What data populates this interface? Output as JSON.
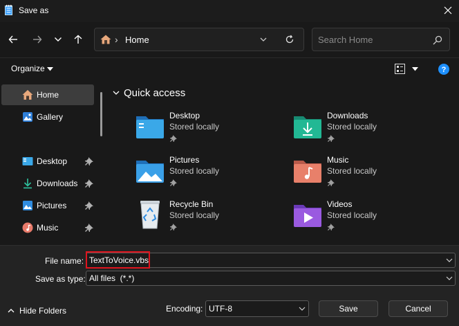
{
  "window": {
    "title": "Save as"
  },
  "address": {
    "location": "Home",
    "separator": "›"
  },
  "search": {
    "placeholder": "Search Home"
  },
  "toolbar": {
    "organize_label": "Organize"
  },
  "sidebar": {
    "items": [
      {
        "label": "Home",
        "icon": "home-icon",
        "selected": true,
        "pinned": false
      },
      {
        "label": "Gallery",
        "icon": "gallery-icon",
        "selected": false,
        "pinned": false
      },
      {
        "label": "Desktop",
        "icon": "desktop-icon",
        "selected": false,
        "pinned": true
      },
      {
        "label": "Downloads",
        "icon": "downloads-icon",
        "selected": false,
        "pinned": true
      },
      {
        "label": "Pictures",
        "icon": "pictures-icon",
        "selected": false,
        "pinned": true
      },
      {
        "label": "Music",
        "icon": "music-icon",
        "selected": false,
        "pinned": true
      }
    ]
  },
  "quick_access": {
    "title": "Quick access",
    "items": [
      {
        "name": "Desktop",
        "status": "Stored locally",
        "icon": "desktop-folder-icon"
      },
      {
        "name": "Downloads",
        "status": "Stored locally",
        "icon": "downloads-folder-icon"
      },
      {
        "name": "Pictures",
        "status": "Stored locally",
        "icon": "pictures-folder-icon"
      },
      {
        "name": "Music",
        "status": "Stored locally",
        "icon": "music-folder-icon"
      },
      {
        "name": "Recycle Bin",
        "status": "Stored locally",
        "icon": "recycle-bin-icon"
      },
      {
        "name": "Videos",
        "status": "Stored locally",
        "icon": "videos-folder-icon"
      }
    ]
  },
  "form": {
    "file_name_label": "File name:",
    "file_name_value": "TextToVoice.vbs",
    "save_as_type_label": "Save as type:",
    "save_as_type_value": "All files  (*.*)",
    "encoding_label": "Encoding:",
    "encoding_value": "UTF-8"
  },
  "footer": {
    "hide_folders_label": "Hide Folders",
    "save_label": "Save",
    "cancel_label": "Cancel"
  },
  "colors": {
    "background": "#191919",
    "accent_blue": "#1e90ff",
    "highlight_red": "#e0141e"
  }
}
